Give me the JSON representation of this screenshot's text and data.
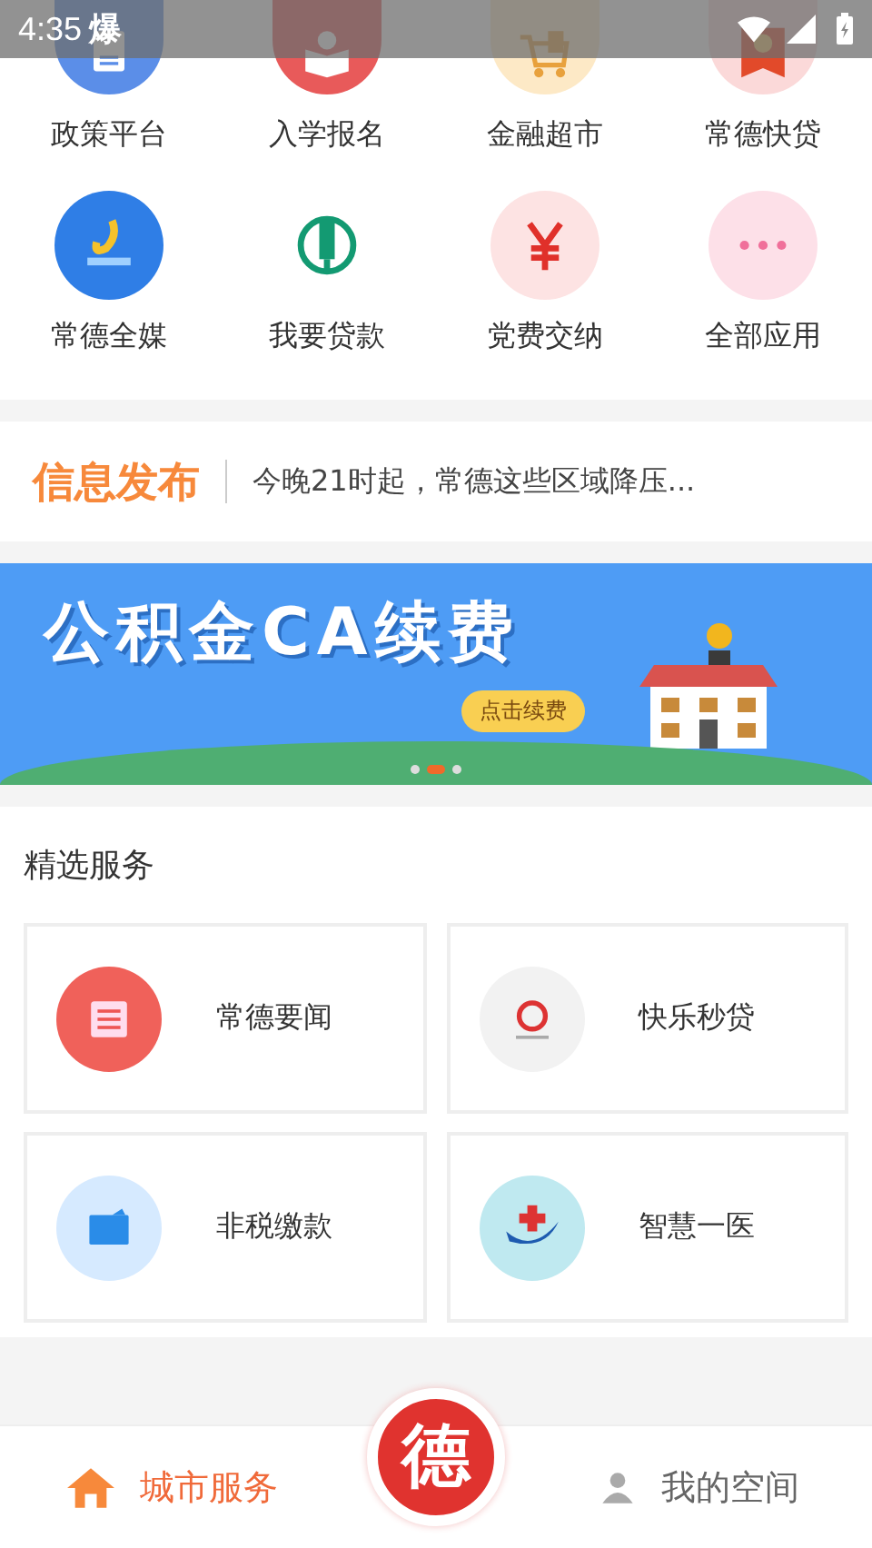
{
  "status_bar": {
    "time": "4:35",
    "notification": "爆"
  },
  "apps": [
    {
      "label": "政策平台"
    },
    {
      "label": "入学报名"
    },
    {
      "label": "金融超市"
    },
    {
      "label": "常德快贷"
    },
    {
      "label": "常德全媒"
    },
    {
      "label": "我要贷款"
    },
    {
      "label": "党费交纳"
    },
    {
      "label": "全部应用"
    }
  ],
  "news": {
    "title": "信息发布",
    "headline": "今晚21时起，常德这些区域降压..."
  },
  "banner": {
    "title": "公积金CA续费",
    "button": "点击续费",
    "dots": [
      {
        "selected": false
      },
      {
        "selected": true
      },
      {
        "selected": false
      }
    ]
  },
  "featured": {
    "title": "精选服务",
    "items": [
      {
        "label": "常德要闻"
      },
      {
        "label": "快乐秒贷"
      },
      {
        "label": "非税缴款"
      },
      {
        "label": "智慧一医"
      }
    ]
  },
  "nav": [
    {
      "label": "城市服务",
      "kind": "tab",
      "selected": true
    },
    {
      "label": "德",
      "kind": "center"
    },
    {
      "label": "我的空间",
      "kind": "tab",
      "selected": false
    }
  ]
}
